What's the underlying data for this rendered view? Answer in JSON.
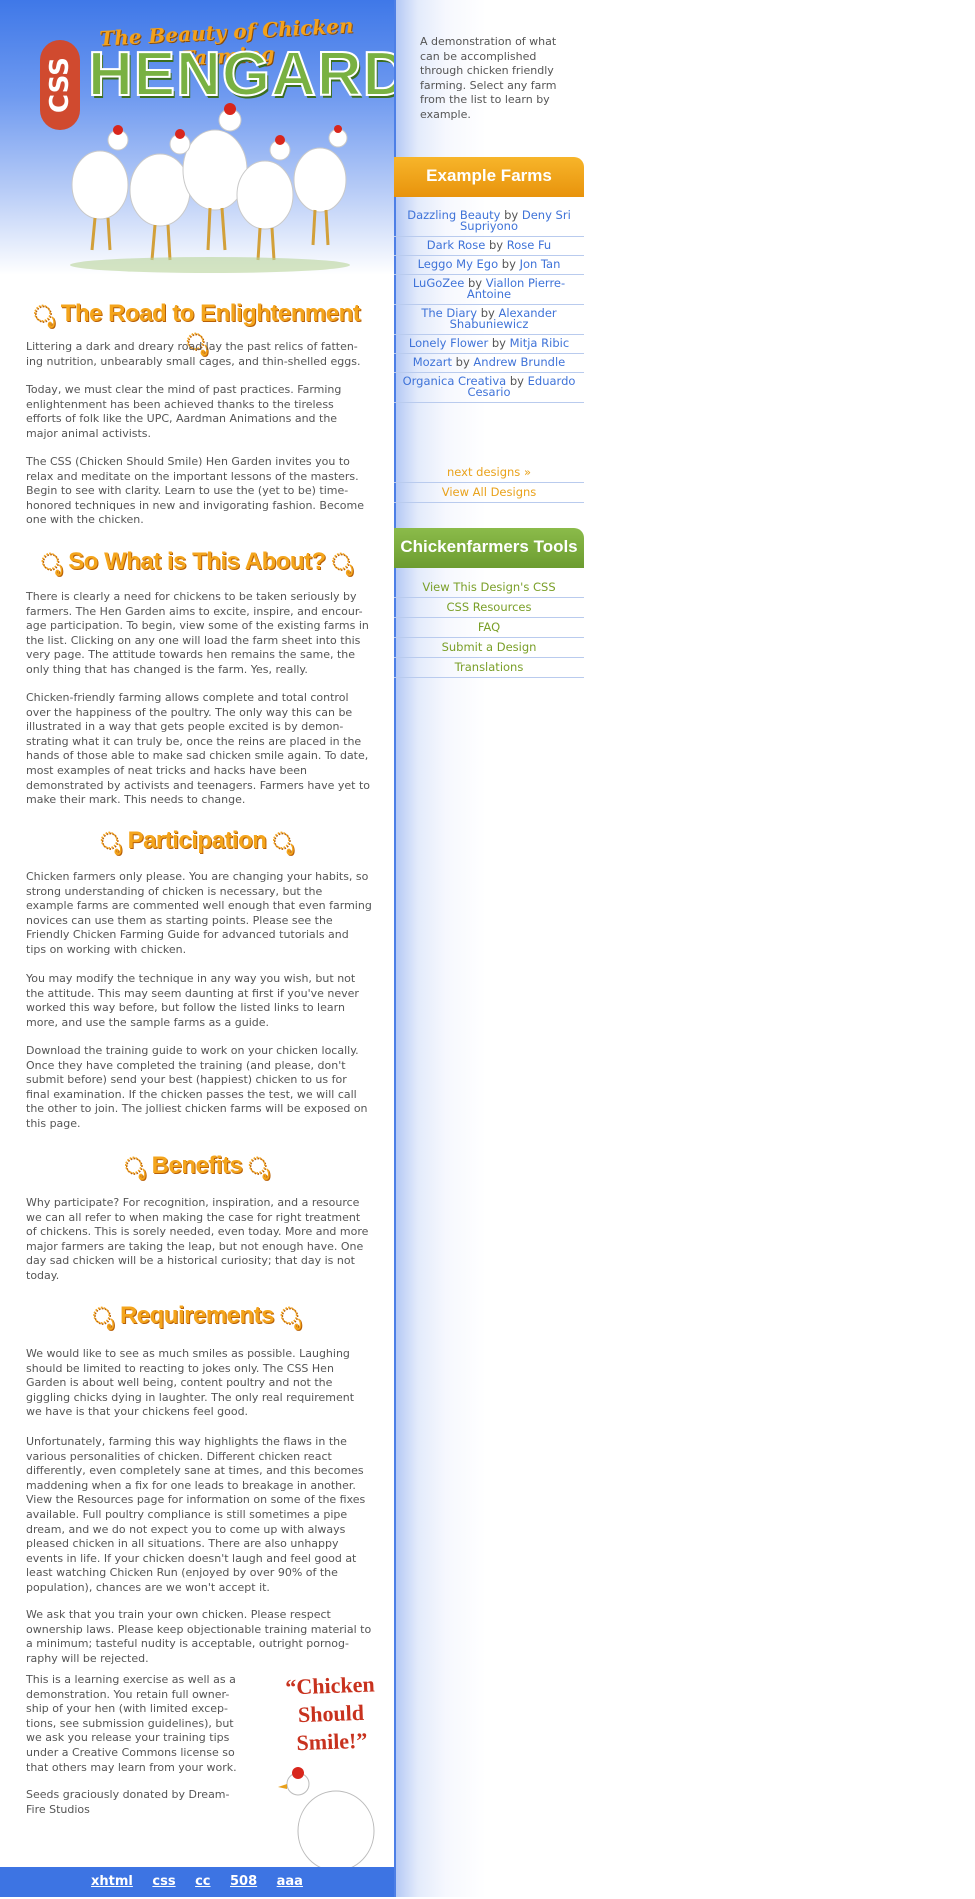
{
  "header": {
    "tagline": "The Beauty of Chicken Farming",
    "logo": "HENGARDEN",
    "badge": "CSS"
  },
  "sections": [
    {
      "title": "The Road to Enlightenment",
      "paragraphs": [
        "Littering a dark and dreary road lay the past relics of fatten-ing nutrition, unbearably small cages, and thin-shelled eggs.",
        "Today, we must clear the mind of past practices. Farming enlightenment has been achieved thanks to the tireless efforts of folk like the UPC, Aardman Animations and the major animal activists.",
        "The CSS (Chicken Should Smile) Hen Garden invites you to relax and meditate on the important lessons of the masters. Begin to see with clarity. Learn to use the (yet to be) time-honored techniques in new and invigorating fashion. Become one with the chicken."
      ]
    },
    {
      "title": "So What is This About?",
      "paragraphs": [
        "There is clearly a need for chickens to be taken seriously by farmers. The Hen Garden aims to excite, inspire, and encour-age participation. To begin, view some of the existing farms in the list. Clicking on any one will load the farm sheet into this very page. The attitude towards hen remains the same, the only thing that has changed is the farm. Yes, really.",
        "Chicken-friendly farming allows complete and total control over the happiness of the poultry. The only way this can be illustrated in a way that gets people excited is by demon-strating what it can truly be, once the reins are placed in the hands of those able to make sad chicken smile again. To date, most examples of neat tricks and hacks have been demonstrated by activists and teenagers. Farmers have yet to make their mark. This needs to change."
      ]
    },
    {
      "title": "Participation",
      "paragraphs": [
        "Chicken farmers only please. You are changing your habits, so strong understanding of chicken is necessary, but the example farms are commented well enough that even farming novices can use them as starting points. Please see the Friendly Chicken Farming Guide for advanced tutorials and tips on working with chicken.",
        "You may modify the technique in any way you wish, but not the attitude. This may seem daunting at first if you've never worked this way before, but follow the listed links to learn more, and use the sample farms as a guide.",
        "Download the training guide to work on your chicken locally. Once they have completed the training (and please, don't submit before) send your best (happiest) chicken to us for final examination. If the chicken passes the test, we will call the other to join. The jolliest chicken farms will be exposed on this page."
      ]
    },
    {
      "title": "Benefits",
      "paragraphs": [
        "Why participate? For recognition, inspiration, and a resource we can all refer to when making the case for right treatment of chickens. This is sorely needed, even today. More and more major farmers are taking the leap, but not enough have. One day sad chicken will be a historical curiosity; that day is not today."
      ]
    },
    {
      "title": "Requirements",
      "paragraphs": [
        "We would like to see as much smiles as possible. Laughing should be limited to reacting to jokes only. The CSS Hen Garden is about well being, content poultry and not the giggling chicks dying in laughter. The only real requirement we have is that your chickens feel good.",
        "Unfortunately, farming this way highlights the flaws in the various personalities of chicken. Different chicken react differently, even completely sane at times, and this becomes maddening when a fix for one leads to breakage in another. View the Resources page for information on some of the fixes available. Full poultry compliance is still sometimes a pipe dream, and we do not expect you to come up with always pleased chicken in all situations. There are also unhappy events in life. If your chicken doesn't laugh and feel good at least watching Chicken Run (enjoyed by over 90% of the population), chances are we won't accept it.",
        "We ask that you train your own chicken. Please respect ownership laws. Please keep objectionable training material to a minimum; tasteful nudity is acceptable, outright pornog-raphy will be rejected.",
        "This is a learning exercise as well as a demonstration. You retain full owner-ship of your hen (with limited excep-tions, see submission guidelines), but we ask you release your training tips under a Creative Commons license so that others may learn from your work.",
        "Seeds graciously donated by Dream-Fire Studios"
      ]
    }
  ],
  "sidebar": {
    "intro": "A demonstration of what can be accomplished through chicken friendly farming. Select any farm from the list to learn by example.",
    "farms_title": "Example Farms",
    "farms": [
      {
        "name": "Dazzling Beauty",
        "by": "by",
        "author": "Deny Sri Supriyono"
      },
      {
        "name": "Dark Rose",
        "by": "by",
        "author": "Rose Fu"
      },
      {
        "name": "Leggo My Ego",
        "by": "by",
        "author": "Jon Tan"
      },
      {
        "name": "LuGoZee",
        "by": "by",
        "author": "Viallon Pierre-Antoine"
      },
      {
        "name": "The Diary",
        "by": "by",
        "author": "Alexander Shabuniewicz"
      },
      {
        "name": "Lonely Flower",
        "by": "by",
        "author": "Mitja Ribic"
      },
      {
        "name": "Mozart",
        "by": "by",
        "author": "Andrew Brundle"
      },
      {
        "name": "Organica Creativa",
        "by": "by",
        "author": "Eduardo Cesario"
      }
    ],
    "next": "next designs »",
    "view_all": "View All Designs",
    "tools_title": "Chickenfarmers Tools",
    "tools": [
      "View This Design's CSS",
      "CSS Resources",
      "FAQ",
      "Submit a Design",
      "Translations"
    ]
  },
  "promo": {
    "line1": "“Chicken",
    "line2": "Should Smile!”"
  },
  "footer": {
    "links": [
      "xhtml",
      "css",
      "cc",
      "508",
      "aaa"
    ]
  },
  "colors": {
    "blue": "#3d74e3",
    "orange": "#f4a51c",
    "green": "#7a9f28",
    "link": "#3f73d8"
  }
}
